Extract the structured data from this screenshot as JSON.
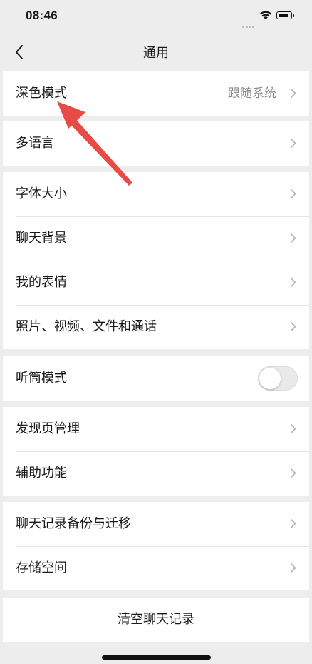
{
  "status_bar": {
    "time": "08:46"
  },
  "nav": {
    "title": "通用",
    "back_icon": "chevron-left-icon"
  },
  "groups": [
    {
      "cells": [
        {
          "label": "深色模式",
          "value": "跟随系统"
        }
      ]
    },
    {
      "cells": [
        {
          "label": "多语言"
        }
      ]
    },
    {
      "cells": [
        {
          "label": "字体大小"
        },
        {
          "label": "聊天背景"
        },
        {
          "label": "我的表情"
        },
        {
          "label": "照片、视频、文件和通话"
        }
      ]
    },
    {
      "cells": [
        {
          "label": "听筒模式",
          "toggle_on": false
        }
      ]
    },
    {
      "cells": [
        {
          "label": "发现页管理"
        },
        {
          "label": "辅助功能"
        }
      ]
    },
    {
      "cells": [
        {
          "label": "聊天记录备份与迁移"
        },
        {
          "label": "存储空间"
        }
      ]
    }
  ],
  "clear_button": {
    "label": "清空聊天记录"
  },
  "colors": {
    "background": "#ededed",
    "cell": "#ffffff",
    "secondary_text": "#888888",
    "annotation_arrow": "#e84a45"
  }
}
